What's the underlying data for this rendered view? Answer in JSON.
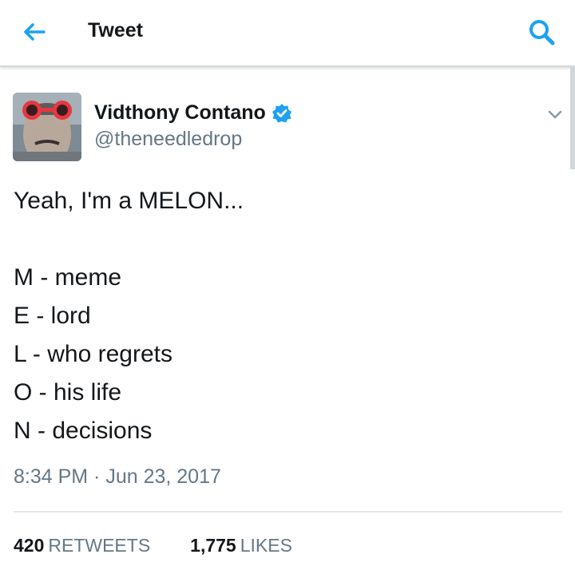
{
  "topbar": {
    "title": "Tweet",
    "back_icon": "back-arrow-icon",
    "search_icon": "search-icon",
    "accent": "#1da1f2"
  },
  "tweet": {
    "author": {
      "name": "Vidthony Contano",
      "handle": "@theneedledrop",
      "verified": true
    },
    "lines": [
      "Yeah, I'm a MELON...",
      "",
      "M - meme",
      "E - lord",
      "L - who regrets",
      "O - his life",
      "N - decisions"
    ],
    "timestamp": "8:34 PM · Jun 23, 2017",
    "stats": {
      "retweets": {
        "count": "420",
        "label": "RETWEETS"
      },
      "likes": {
        "count": "1,775",
        "label": "LIKES"
      }
    }
  }
}
